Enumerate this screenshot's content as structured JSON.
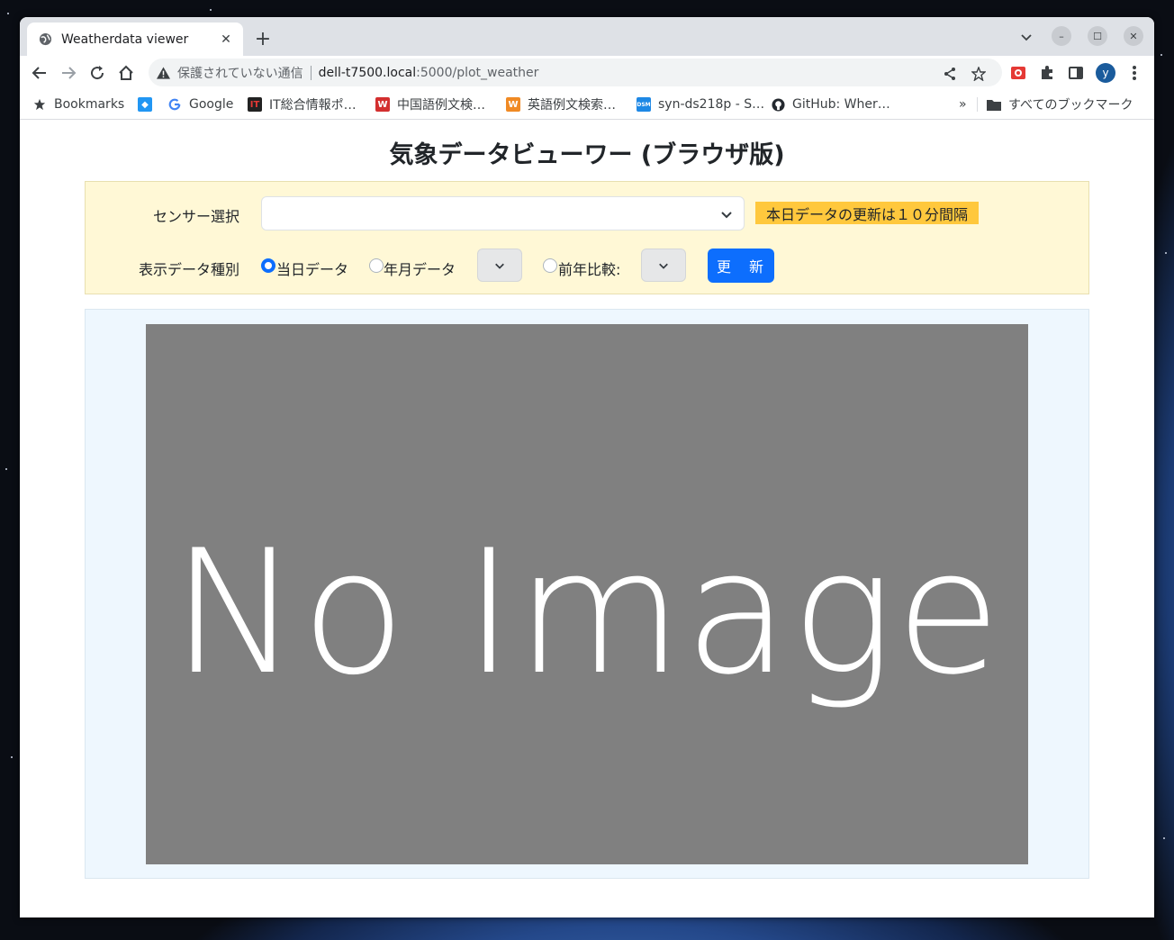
{
  "browser": {
    "tab": {
      "title": "Weatherdata viewer",
      "close": "✕"
    },
    "new_tab": "+",
    "window_controls": {
      "minimize": "–",
      "maximize": "☐",
      "close": "✕"
    },
    "omnibox": {
      "security_text": "保護されていない通信",
      "host": "dell-t7500.local",
      "path": ":5000/plot_weather"
    },
    "profile_initial": "y",
    "bookmarks": [
      {
        "label": "Bookmarks",
        "icon": "star-icon"
      },
      {
        "label": "",
        "icon": "app-icon"
      },
      {
        "label": "Google",
        "icon": "google-icon"
      },
      {
        "label": "IT総合情報ポ…",
        "icon": "it-icon"
      },
      {
        "label": "中国語例文検…",
        "icon": "w-red-icon"
      },
      {
        "label": "英語例文検索…",
        "icon": "w-orange-icon"
      },
      {
        "label": "syn-ds218p - S…",
        "icon": "dsm-icon"
      },
      {
        "label": "GitHub: Wher…",
        "icon": "github-icon"
      }
    ],
    "bookmarks_overflow": "»",
    "all_bookmarks": "すべてのブックマーク"
  },
  "page": {
    "title": "気象データビューワー (ブラウザ版)",
    "sensor_label": "センサー選択",
    "sensor_value": "",
    "notice": "本日データの更新は１０分間隔",
    "data_type_label": "表示データ種別",
    "options": {
      "today": "当日データ",
      "month": "年月データ",
      "compare": "前年比較:"
    },
    "selected_option": "today",
    "update_button": "更　新",
    "image_placeholder": "No Image"
  },
  "colors": {
    "control_panel_bg": "#fff8d6",
    "notice_bg": "#ffc83d",
    "primary": "#0d6efd",
    "image_panel_bg": "#eef7fe",
    "placeholder_bg": "#808080"
  }
}
